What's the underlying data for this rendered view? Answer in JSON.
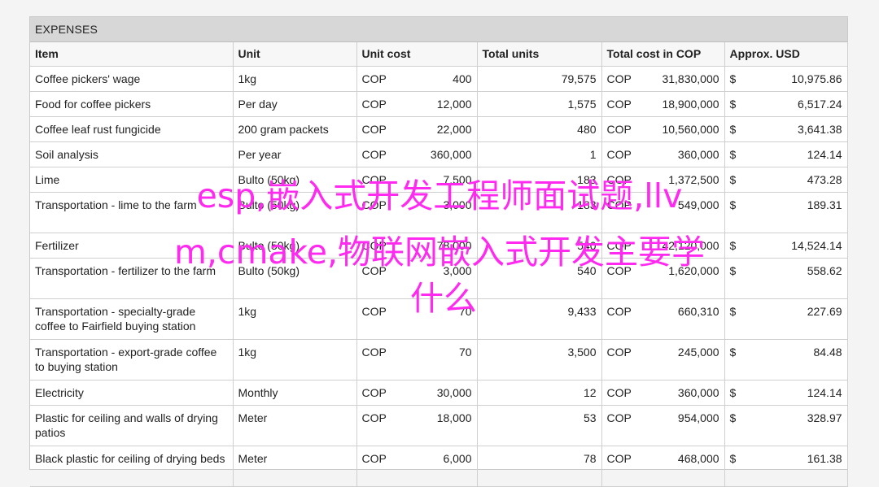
{
  "sheet": {
    "title": "EXPENSES",
    "headers": [
      "Item",
      "Unit",
      "Unit cost",
      "Total units",
      "Total cost in COP",
      "Approx. USD"
    ],
    "rows": [
      {
        "item": "Coffee pickers' wage",
        "unit": "1kg",
        "unit_cur": "COP",
        "unit_cost": "400",
        "total_units": "79,575",
        "total_cur": "COP",
        "total_cost": "31,830,000",
        "usd_cur": "$",
        "usd": "10,975.86"
      },
      {
        "item": "Food for coffee pickers",
        "unit": "Per day",
        "unit_cur": "COP",
        "unit_cost": "12,000",
        "total_units": "1,575",
        "total_cur": "COP",
        "total_cost": "18,900,000",
        "usd_cur": "$",
        "usd": "6,517.24"
      },
      {
        "item": "Coffee leaf rust fungicide",
        "unit": "200 gram packets",
        "unit_cur": "COP",
        "unit_cost": "22,000",
        "total_units": "480",
        "total_cur": "COP",
        "total_cost": "10,560,000",
        "usd_cur": "$",
        "usd": "3,641.38"
      },
      {
        "item": "Soil analysis",
        "unit": "Per year",
        "unit_cur": "COP",
        "unit_cost": "360,000",
        "total_units": "1",
        "total_cur": "COP",
        "total_cost": "360,000",
        "usd_cur": "$",
        "usd": "124.14"
      },
      {
        "item": "Lime",
        "unit": "Bulto (50kg)",
        "unit_cur": "COP",
        "unit_cost": "7,500",
        "total_units": "183",
        "total_cur": "COP",
        "total_cost": "1,372,500",
        "usd_cur": "$",
        "usd": "473.28"
      },
      {
        "item": "Transportation - lime to the farm",
        "unit": "Bulto (50kg)",
        "unit_cur": "COP",
        "unit_cost": "3,000",
        "total_units": "183",
        "total_cur": "COP",
        "total_cost": "549,000",
        "usd_cur": "$",
        "usd": "189.31"
      },
      {
        "item": "Fertilizer",
        "unit": "Bulto (50kg)",
        "unit_cur": "COP",
        "unit_cost": "78,000",
        "total_units": "540",
        "total_cur": "COP",
        "total_cost": "42,120,000",
        "usd_cur": "$",
        "usd": "14,524.14"
      },
      {
        "item": "Transportation - fertilizer to the farm",
        "unit": "Bulto (50kg)",
        "unit_cur": "COP",
        "unit_cost": "3,000",
        "total_units": "540",
        "total_cur": "COP",
        "total_cost": "1,620,000",
        "usd_cur": "$",
        "usd": "558.62"
      },
      {
        "item": "Transportation - specialty-grade coffee to Fairfield buying station",
        "unit": "1kg",
        "unit_cur": "COP",
        "unit_cost": "70",
        "total_units": "9,433",
        "total_cur": "COP",
        "total_cost": "660,310",
        "usd_cur": "$",
        "usd": "227.69"
      },
      {
        "item": "Transportation - export-grade coffee to buying station",
        "unit": "1kg",
        "unit_cur": "COP",
        "unit_cost": "70",
        "total_units": "3,500",
        "total_cur": "COP",
        "total_cost": "245,000",
        "usd_cur": "$",
        "usd": "84.48"
      },
      {
        "item": "Electricity",
        "unit": "Monthly",
        "unit_cur": "COP",
        "unit_cost": "30,000",
        "total_units": "12",
        "total_cur": "COP",
        "total_cost": "360,000",
        "usd_cur": "$",
        "usd": "124.14"
      },
      {
        "item": "Plastic for ceiling and walls of drying patios",
        "unit": "Meter",
        "unit_cur": "COP",
        "unit_cost": "18,000",
        "total_units": "53",
        "total_cur": "COP",
        "total_cost": "954,000",
        "usd_cur": "$",
        "usd": "328.97"
      },
      {
        "item": "Black plastic for ceiling of drying beds",
        "unit": "Meter",
        "unit_cur": "COP",
        "unit_cost": "6,000",
        "total_units": "78",
        "total_cur": "COP",
        "total_cost": "468,000",
        "usd_cur": "$",
        "usd": "161.38"
      }
    ]
  },
  "overlay": {
    "line1": "esp,嵌入式开发工程师面试题,llv",
    "line2": "m,cmake,物联网嵌入式开发主要学",
    "line3": "什么"
  }
}
